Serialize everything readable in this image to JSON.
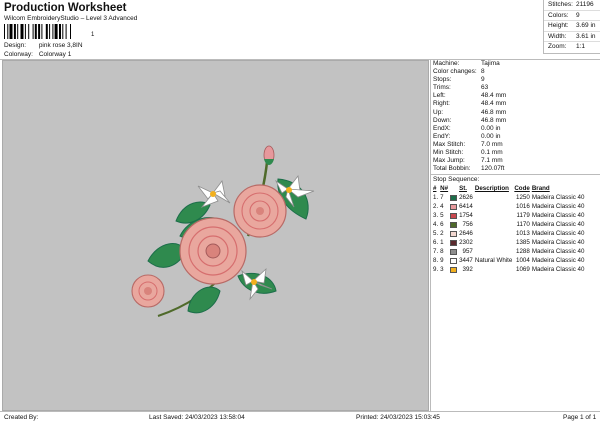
{
  "header": {
    "title": "Production Worksheet",
    "subtitle": "Wilcom EmbroideryStudio – Level 3 Advanced",
    "barcode_suffix": "1",
    "design_label": "Design:",
    "design_value": "pink rose 3,8IN",
    "colorway_label": "Colorway:",
    "colorway_value": "Colorway 1"
  },
  "topstats": [
    {
      "label": "Stitches:",
      "value": "21196"
    },
    {
      "label": "Colors:",
      "value": "9"
    },
    {
      "label": "Height:",
      "value": "3.69 in"
    },
    {
      "label": "Width:",
      "value": "3.61 in"
    },
    {
      "label": "Zoom:",
      "value": "1:1"
    }
  ],
  "machine_stats": [
    {
      "label": "Machine:",
      "value": "Tajima"
    },
    {
      "label": "Color changes:",
      "value": "8"
    },
    {
      "label": "Stops:",
      "value": "9"
    },
    {
      "label": "Trims:",
      "value": "63"
    },
    {
      "label": "Left:",
      "value": "48.4 mm"
    },
    {
      "label": "Right:",
      "value": "48.4 mm"
    },
    {
      "label": "Up:",
      "value": "46.8 mm"
    },
    {
      "label": "Down:",
      "value": "46.8 mm"
    },
    {
      "label": "EndX:",
      "value": "0.00 in"
    },
    {
      "label": "EndY:",
      "value": "0.00 in"
    },
    {
      "label": "Max Stitch:",
      "value": "7.0 mm"
    },
    {
      "label": "Min Stitch:",
      "value": "0.1 mm"
    },
    {
      "label": "Max Jump:",
      "value": "7.1 mm"
    },
    {
      "label": "Total Bobbin:",
      "value": "120.07ft"
    }
  ],
  "stop_sequence": {
    "title": "Stop Sequence:",
    "headers": [
      "#",
      "N#",
      "St.",
      "Description",
      "Code",
      "Brand"
    ],
    "rows": [
      {
        "num": "1.",
        "n": "7",
        "color": "#1c6e4a",
        "st": "2626",
        "desc": "",
        "code": "1250",
        "brand": "Madeira Classic 40"
      },
      {
        "num": "2.",
        "n": "4",
        "color": "#e6989c",
        "st": "6414",
        "desc": "",
        "code": "1016",
        "brand": "Madeira Classic 40"
      },
      {
        "num": "3.",
        "n": "5",
        "color": "#c9484f",
        "st": "1754",
        "desc": "",
        "code": "1179",
        "brand": "Madeira Classic 40"
      },
      {
        "num": "4.",
        "n": "6",
        "color": "#4f6a2a",
        "st": "756",
        "desc": "",
        "code": "1170",
        "brand": "Madeira Classic 40"
      },
      {
        "num": "5.",
        "n": "2",
        "color": "#f3d8d1",
        "st": "2646",
        "desc": "",
        "code": "1013",
        "brand": "Madeira Classic 40"
      },
      {
        "num": "6.",
        "n": "1",
        "color": "#5a2a2e",
        "st": "2302",
        "desc": "",
        "code": "1385",
        "brand": "Madeira Classic 40"
      },
      {
        "num": "7.",
        "n": "8",
        "color": "#8e8e8e",
        "st": "957",
        "desc": "",
        "code": "1288",
        "brand": "Madeira Classic 40"
      },
      {
        "num": "8.",
        "n": "9",
        "color": "#ffffff",
        "st": "3447",
        "desc": "Natural White",
        "code": "1004",
        "brand": "Madeira Classic 40"
      },
      {
        "num": "9.",
        "n": "3",
        "color": "#f2b01e",
        "st": "392",
        "desc": "",
        "code": "1069",
        "brand": "Madeira Classic 40"
      }
    ]
  },
  "footer": {
    "created_by": "Created By:",
    "last_saved": "Last Saved: 24/03/2023 13:58:04",
    "printed": "Printed: 24/03/2023 15:03:45",
    "page": "Page 1 of 1"
  }
}
